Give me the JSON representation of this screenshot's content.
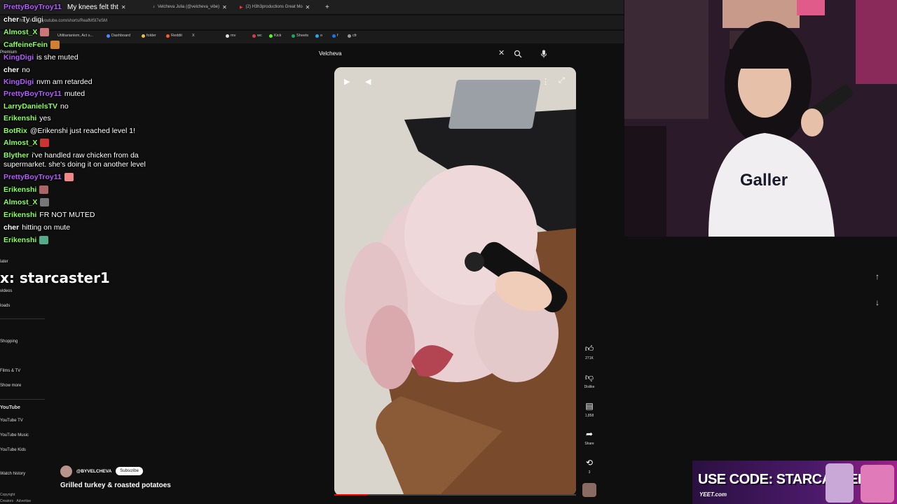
{
  "browser": {
    "tabs": [
      {
        "label": "My knees felt tht",
        "active": true
      },
      {
        "label": "Velcheva Julia (@velcheva_vibe)"
      },
      {
        "label": "(2) H3h3productions Great Mo"
      }
    ],
    "url": "https://www.youtube.com/shorts/ReafMSl7eSM",
    "bookmarks": [
      "Utilitarianism, Act s...",
      "Dashboard",
      "folder",
      "Reddit",
      "X",
      "mv",
      "wc",
      "Kick",
      "Sheets",
      "o",
      "f",
      "cfr"
    ]
  },
  "sidebar": {
    "items": [
      "Premium",
      "Shopping",
      "Films & TV",
      "Show more",
      "YouTube",
      "YouTube TV",
      "YouTube Music",
      "YouTube Kids",
      "Watch history",
      "Copyright",
      "Creators · Advertise",
      "later",
      "videos",
      "loads"
    ],
    "section_title": "YouTube"
  },
  "chat": {
    "messages": [
      {
        "user": "PrettyBoyTroy11",
        "text": "",
        "color": "#b45cff"
      },
      {
        "user": "cher",
        "text": "Ty digi",
        "color": "#ffffff"
      },
      {
        "user": "Almost_X",
        "text": "",
        "color": "#8cff5a",
        "emote": "#c77"
      },
      {
        "user": "CaffeineFein",
        "text": "",
        "color": "#8cff5a",
        "emote": "#d08030"
      },
      {
        "user": "KingDigi",
        "text": "is she muted",
        "color": "#b45cff"
      },
      {
        "user": "cher",
        "text": "no",
        "color": "#ffffff"
      },
      {
        "user": "KingDigi",
        "text": "nvm am retarded",
        "color": "#b45cff"
      },
      {
        "user": "PrettyBoyTroy11",
        "text": "muted",
        "color": "#b45cff"
      },
      {
        "user": "LarryDanielsTV",
        "text": "no",
        "color": "#8cff5a"
      },
      {
        "user": "Erikenshi",
        "text": "yes",
        "color": "#8cff5a"
      },
      {
        "user": "BotRix",
        "text": "@Erikenshi just reached level 1!",
        "color": "#8cff5a"
      },
      {
        "user": "Almost_X",
        "text": "",
        "color": "#8cff5a",
        "emote": "#c33"
      },
      {
        "user": "Blyther",
        "text": "i've handled raw chicken from da",
        "color": "#8cff5a"
      },
      {
        "user": "",
        "text": "supermarket. she's doing it on another level",
        "color": "#ffffff"
      },
      {
        "user": "PrettyBoyTroy11",
        "text": "",
        "color": "#b45cff",
        "emote": "#e88"
      },
      {
        "user": "Erikenshi",
        "text": "",
        "color": "#8cff5a",
        "emote": "#a66"
      },
      {
        "user": "Almost_X",
        "text": "",
        "color": "#8cff5a",
        "emote": "#777"
      },
      {
        "user": "Erikenshi",
        "text": "FR NOT MUTED",
        "color": "#8cff5a"
      },
      {
        "user": "cher",
        "text": "hitting on mute",
        "color": "#ffffff"
      },
      {
        "user": "Erikenshi",
        "text": "",
        "color": "#8cff5a",
        "emote": "#5a8"
      }
    ]
  },
  "overlay": {
    "handle": "x: starcaster1"
  },
  "search": {
    "query": "Velcheva"
  },
  "video": {
    "progress_fraction": 0.14,
    "channel": "@BYVELCHEVA",
    "subscribe_label": "Subscribe",
    "title": "Grilled turkey & roasted potatoes"
  },
  "actions": {
    "like_count": "271K",
    "dislike_label": "Dislike",
    "comment_count": "1,858",
    "share_label": "Share",
    "remix_count": "3"
  },
  "promo": {
    "code_text": "USE CODE: STARCASTER",
    "brand": "YEET.com"
  },
  "colors": {
    "accent_red": "#ff0000",
    "chat_green": "#8cff5a",
    "chat_purple": "#b45cff"
  }
}
